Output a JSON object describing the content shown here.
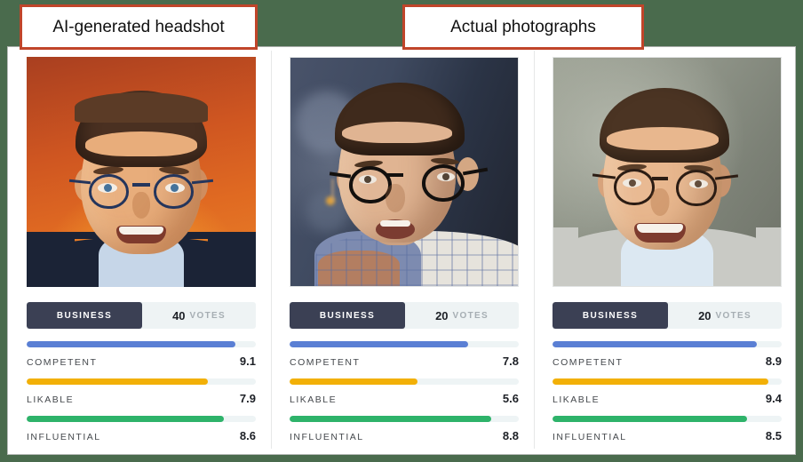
{
  "page": {
    "background_color": "#4a6b4d",
    "panel_background": "#ffffff"
  },
  "callouts": [
    {
      "id": "ai",
      "label": "AI-generated headshot",
      "border_color": "#c0452a"
    },
    {
      "id": "actual",
      "label": "Actual photographs",
      "border_color": "#c0452a"
    }
  ],
  "trait_colors": {
    "competent": "#5a7fd4",
    "likable": "#f2b007",
    "influential": "#2eb36a"
  },
  "cards": [
    {
      "portrait": {
        "kind": "ai-generated-headshot",
        "background": "orange-studio-gradient",
        "description": "Man with short brown hair, blue-rimmed glasses, smiling, dark suit and light blue shirt"
      },
      "category": "BUSINESS",
      "votes_count": "40",
      "votes_label": "VOTES",
      "traits": [
        {
          "name": "COMPETENT",
          "score": "9.1",
          "value": 9.1
        },
        {
          "name": "LIKABLE",
          "score": "7.9",
          "value": 7.9
        },
        {
          "name": "INFLUENTIAL",
          "score": "8.6",
          "value": 8.6
        }
      ]
    },
    {
      "portrait": {
        "kind": "actual-photograph",
        "background": "dark-blue-stage-blur",
        "description": "Man with glasses speaking on stage, checkered shirt, blurred dark blue background"
      },
      "category": "BUSINESS",
      "votes_count": "20",
      "votes_label": "VOTES",
      "traits": [
        {
          "name": "COMPETENT",
          "score": "7.8",
          "value": 7.8
        },
        {
          "name": "LIKABLE",
          "score": "5.6",
          "value": 5.6
        },
        {
          "name": "INFLUENTIAL",
          "score": "8.8",
          "value": 8.8
        }
      ]
    },
    {
      "portrait": {
        "kind": "actual-photograph",
        "background": "gray-green-studio",
        "description": "Smiling man with glasses in gray sweater over light blue shirt"
      },
      "category": "BUSINESS",
      "votes_count": "20",
      "votes_label": "VOTES",
      "traits": [
        {
          "name": "COMPETENT",
          "score": "8.9",
          "value": 8.9
        },
        {
          "name": "LIKABLE",
          "score": "9.4",
          "value": 9.4
        },
        {
          "name": "INFLUENTIAL",
          "score": "8.5",
          "value": 8.5
        }
      ]
    }
  ]
}
